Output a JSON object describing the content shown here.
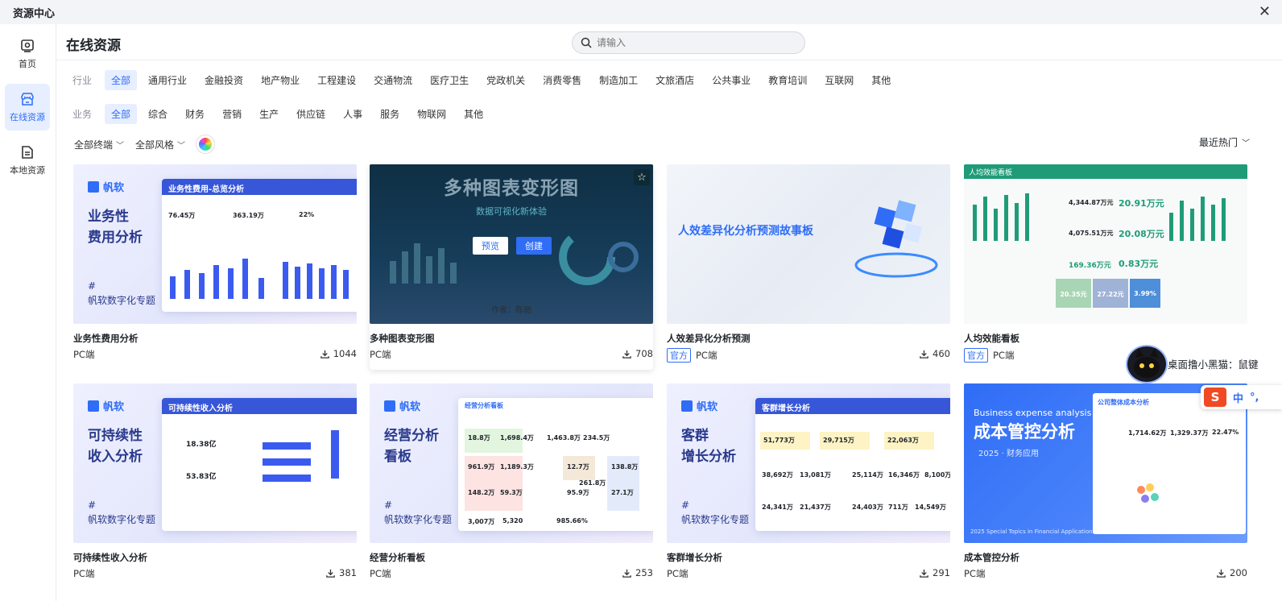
{
  "window": {
    "title": "资源中心",
    "close_icon": "close-icon"
  },
  "sidebar": {
    "items": [
      {
        "label": "首页",
        "icon": "home-icon",
        "active": false
      },
      {
        "label": "在线资源",
        "icon": "store-icon",
        "active": true
      },
      {
        "label": "本地资源",
        "icon": "document-icon",
        "active": false
      }
    ]
  },
  "header": {
    "title": "在线资源",
    "search_placeholder": "请输入"
  },
  "filters": {
    "industry": {
      "label": "行业",
      "options": [
        "全部",
        "通用行业",
        "金融投资",
        "地产物业",
        "工程建设",
        "交通物流",
        "医疗卫生",
        "党政机关",
        "消费零售",
        "制造加工",
        "文旅酒店",
        "公共事业",
        "教育培训",
        "互联网",
        "其他"
      ]
    },
    "business": {
      "label": "业务",
      "options": [
        "全部",
        "综合",
        "财务",
        "营销",
        "生产",
        "供应链",
        "人事",
        "服务",
        "物联网",
        "其他"
      ]
    },
    "terminal": "全部终端",
    "style": "全部风格",
    "sort": "最近热门"
  },
  "cards": [
    {
      "name": "业务性费用分析",
      "platform": "PC端",
      "official": false,
      "downloads": "1044",
      "thumb": {
        "logo": "帆软",
        "line1": "业务性",
        "line2": "费用分析",
        "hash": "#",
        "topic": "帆软数字化专题",
        "panel_title": "业务性费用-总览分析",
        "kpi1": "76.45万",
        "kpi2": "363.19万",
        "kpi3": "22%"
      }
    },
    {
      "name": "多种图表变形图",
      "platform": "PC端",
      "official": false,
      "downloads": "708",
      "thumb": {
        "title": "多种图表变形图",
        "subtitle": "数据可视化新体验",
        "author": "作者：陈驰",
        "preview_label": "预览",
        "create_label": "创建"
      }
    },
    {
      "name": "人效差异化分析预测",
      "platform": "PC端",
      "official": true,
      "official_label": "官方",
      "downloads": "460",
      "thumb": {
        "title": "人效差异化分析预测故事板"
      }
    },
    {
      "name": "人均效能看板",
      "platform": "PC端",
      "official": true,
      "official_label": "官方",
      "downloads": "",
      "thumb": {
        "title": "人均效能看板",
        "kpi1": "4,344.87万元",
        "kpi2": "20.91万元",
        "kpi3": "4,075.51万元",
        "kpi4": "20.08万元",
        "kpi5": "169.36万元",
        "kpi6": "0.83万元",
        "kpi7": "20.35元",
        "kpi8": "27.22元",
        "kpi9": "3.99%"
      }
    },
    {
      "name": "可持续性收入分析",
      "platform": "PC端",
      "official": false,
      "downloads": "381",
      "thumb": {
        "logo": "帆软",
        "line1": "可持续性",
        "line2": "收入分析",
        "hash": "#",
        "topic": "帆软数字化专题",
        "panel_title": "可持续性收入分析",
        "kpi1": "18.38亿",
        "kpi2": "53.83亿"
      }
    },
    {
      "name": "经营分析看板",
      "platform": "PC端",
      "official": false,
      "downloads": "253",
      "thumb": {
        "logo": "帆软",
        "line1": "经营分析",
        "line2": "看板",
        "hash": "#",
        "topic": "帆软数字化专题",
        "panel_title": "经营分析看板",
        "kpi1": "18.8万",
        "kpi2": "1,698.4万",
        "kpi3": "1,463.8万",
        "kpi4": "234.5万",
        "kpi5": "961.9万",
        "kpi6": "1,189.3万",
        "kpi7": "12.7万",
        "kpi8": "261.8万",
        "kpi9": "138.8万",
        "kpi10": "148.2万",
        "kpi11": "59.3万",
        "kpi12": "95.9万",
        "kpi13": "27.1万",
        "kpi14": "3,007万",
        "kpi15": "5,320",
        "kpi16": "985.66%"
      }
    },
    {
      "name": "客群增长分析",
      "platform": "PC端",
      "official": false,
      "downloads": "291",
      "thumb": {
        "logo": "帆软",
        "line1": "客群",
        "line2": "增长分析",
        "hash": "#",
        "topic": "帆软数字化专题",
        "panel_title": "客群增长分析",
        "kpi1": "51,773万",
        "kpi2": "29,715万",
        "kpi3": "22,063万",
        "kpi4": "38,692万",
        "kpi5": "13,081万",
        "kpi6": "25,114万",
        "kpi7": "16,346万",
        "kpi8": "8,100万",
        "kpi9": "24,341万",
        "kpi10": "21,437万",
        "kpi11": "24,403万",
        "kpi12": "711万",
        "kpi13": "14,549万"
      }
    },
    {
      "name": "成本管控分析",
      "platform": "PC端",
      "official": false,
      "downloads": "200",
      "thumb": {
        "kicker": "Business expense analysis",
        "title": "成本管控分析",
        "sub": "2025 · 财务应用",
        "footer": "2025 Special Topics in Financial Applications - Phase 1",
        "panel_title": "公司整体成本分析",
        "kpi1": "1,714.62万",
        "kpi2": "1,329.37万",
        "kpi3": "22.47%"
      }
    }
  ],
  "overlay": {
    "mascot_text": "桌面撸小黑猫：鼠键",
    "ime_label": "中",
    "ime_punct": "°,",
    "ime_logo": "S"
  },
  "colors": {
    "accent": "#2f6df6",
    "active_bg": "#e6eeff"
  }
}
